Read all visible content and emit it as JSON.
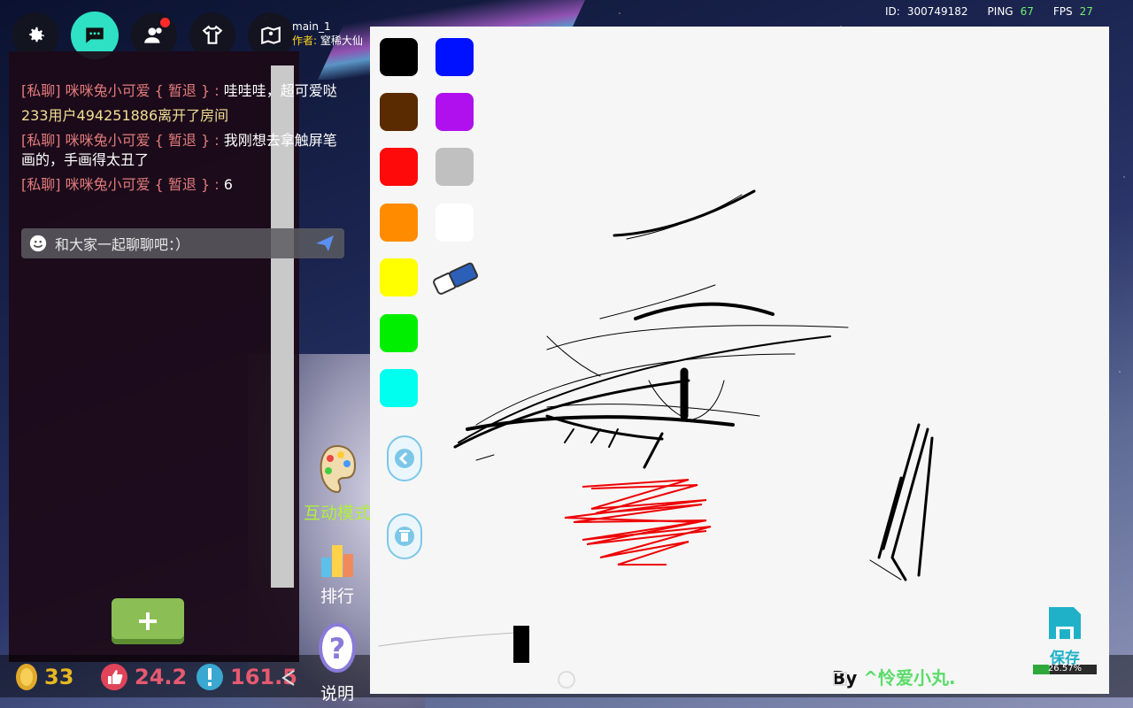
{
  "topbar": {
    "room_name": "main_1",
    "author_label": "作者:",
    "author_name": "窒稀大仙",
    "id_label": "ID:",
    "id_value": "300749182",
    "ping_label": "PING",
    "ping_value": "67",
    "fps_label": "FPS",
    "fps_value": "27"
  },
  "chat": {
    "messages": [
      {
        "tag": "[私聊] 咪咪兔小可爱 { 暂退 } :",
        "text": " 哇哇哇，超可爱哒"
      },
      {
        "tag": "",
        "system": "233用户494251886离开了房间"
      },
      {
        "tag": "[私聊] 咪咪兔小可爱 { 暂退 } :",
        "text": " 我刚想去拿触屏笔画的，手画得太丑了"
      },
      {
        "tag": "[私聊] 咪咪兔小可爱 { 暂退 } :",
        "text": " 6"
      }
    ],
    "input_placeholder": "和大家一起聊聊吧：）"
  },
  "side_buttons": {
    "interact_mode": "互动模式",
    "ranking": "排行",
    "help": "说明"
  },
  "bottom_stats": {
    "coins": "33",
    "likes": "24.2",
    "alerts": "161.5"
  },
  "canvas": {
    "palette_colors": [
      "#000000",
      "#0000ff",
      "#5a2a00",
      "#b010ee",
      "#ff0000",
      "#c0c0c0",
      "#ff8c00",
      "#ffffff",
      "#ffff00",
      "#ffffff00",
      "#00ee00",
      "#ffffff00",
      "#00ffee"
    ],
    "save_label": "保存",
    "progress_percent": 26.57,
    "progress_text": "26.57%",
    "by_label": "By",
    "by_name": "^怜爱小丸."
  },
  "colors": {
    "accent_teal": "#2ee0c4",
    "system_msg": "#f3df94",
    "private_tag": "#e27b7b",
    "mode_green": "#aef03a"
  }
}
